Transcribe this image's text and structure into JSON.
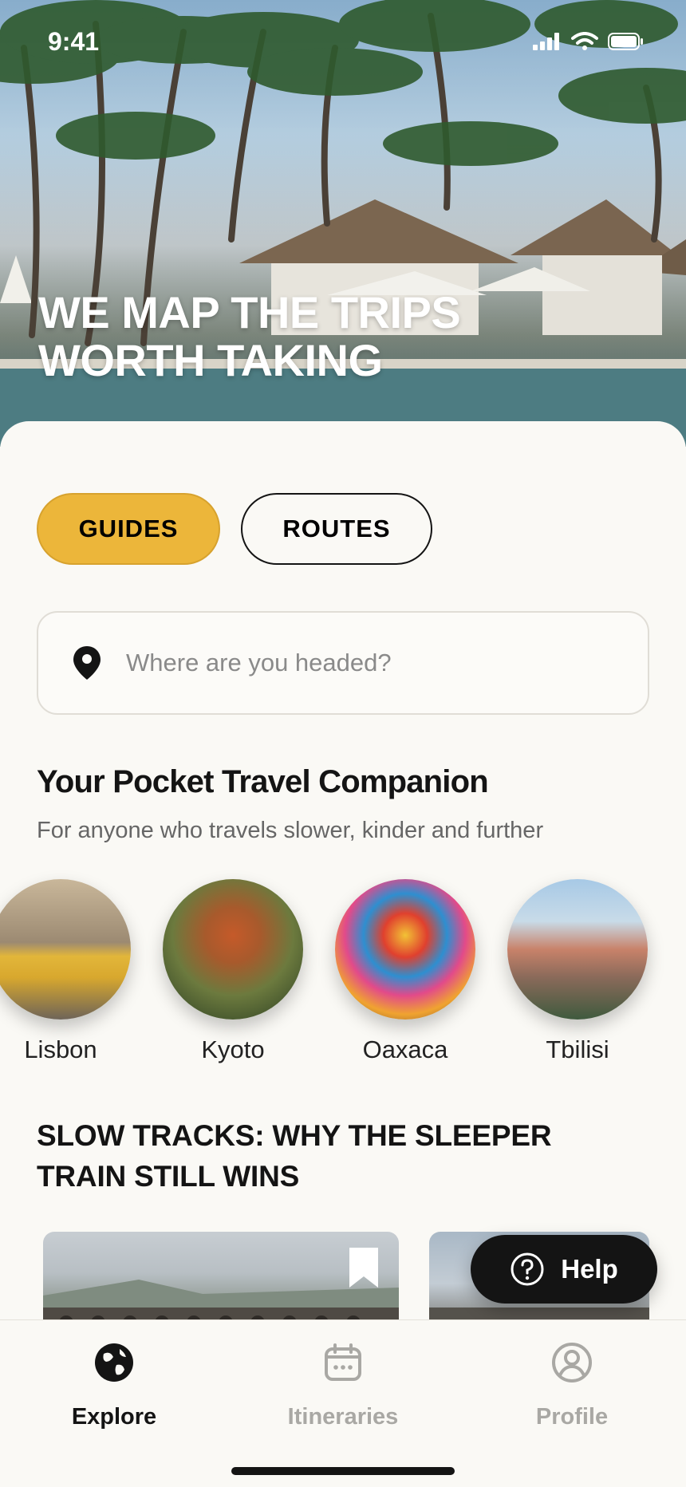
{
  "status": {
    "time": "9:41"
  },
  "hero": {
    "title": "WE MAP THE TRIPS WORTH TAKING"
  },
  "tabs": [
    {
      "label": "GUIDES",
      "active": true
    },
    {
      "label": "ROUTES",
      "active": false
    }
  ],
  "search": {
    "placeholder": "Where are you headed?",
    "icon": "location-pin-icon"
  },
  "section": {
    "title": "Your Pocket Travel Companion",
    "subtitle": "For anyone who travels slower, kinder and further"
  },
  "cities": [
    {
      "name": "Lisbon"
    },
    {
      "name": "Kyoto"
    },
    {
      "name": "Oaxaca"
    },
    {
      "name": "Tbilisi"
    }
  ],
  "article": {
    "title": "SLOW TRACKS: WHY THE SLEEPER TRAIN STILL WINS"
  },
  "help": {
    "label": "Help",
    "icon": "question-circle-icon"
  },
  "tabbar": [
    {
      "label": "Explore",
      "icon": "globe-icon",
      "active": true
    },
    {
      "label": "Itineraries",
      "icon": "calendar-icon",
      "active": false
    },
    {
      "label": "Profile",
      "icon": "user-circle-icon",
      "active": false
    }
  ],
  "colors": {
    "accent": "#ecb63a",
    "ink": "#141414",
    "background": "#faf9f5",
    "muted": "#a9a8a4"
  }
}
